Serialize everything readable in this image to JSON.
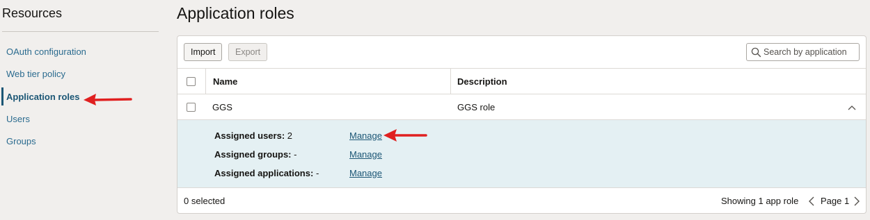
{
  "sidebar": {
    "title": "Resources",
    "items": [
      {
        "label": "OAuth configuration"
      },
      {
        "label": "Web tier policy"
      },
      {
        "label": "Application roles"
      },
      {
        "label": "Users"
      },
      {
        "label": "Groups"
      }
    ]
  },
  "page": {
    "title": "Application roles"
  },
  "toolbar": {
    "import_label": "Import",
    "export_label": "Export",
    "search_placeholder": "Search by application"
  },
  "table": {
    "columns": [
      "Name",
      "Description"
    ],
    "rows": [
      {
        "name": "GGS",
        "description": "GGS role"
      }
    ],
    "detail": {
      "assigned_users_label": "Assigned users:",
      "assigned_users_value": "2",
      "assigned_groups_label": "Assigned groups:",
      "assigned_groups_value": "-",
      "assigned_apps_label": "Assigned applications:",
      "assigned_apps_value": "-",
      "manage_label": "Manage"
    }
  },
  "footer": {
    "selected_text": "0 selected",
    "showing_text": "Showing 1 app role",
    "page_text": "Page 1"
  },
  "colors": {
    "accent": "#1b5675",
    "link": "#2b6b8f",
    "detail_bg": "#e4f0f3",
    "annotation_arrow": "#e02020"
  }
}
